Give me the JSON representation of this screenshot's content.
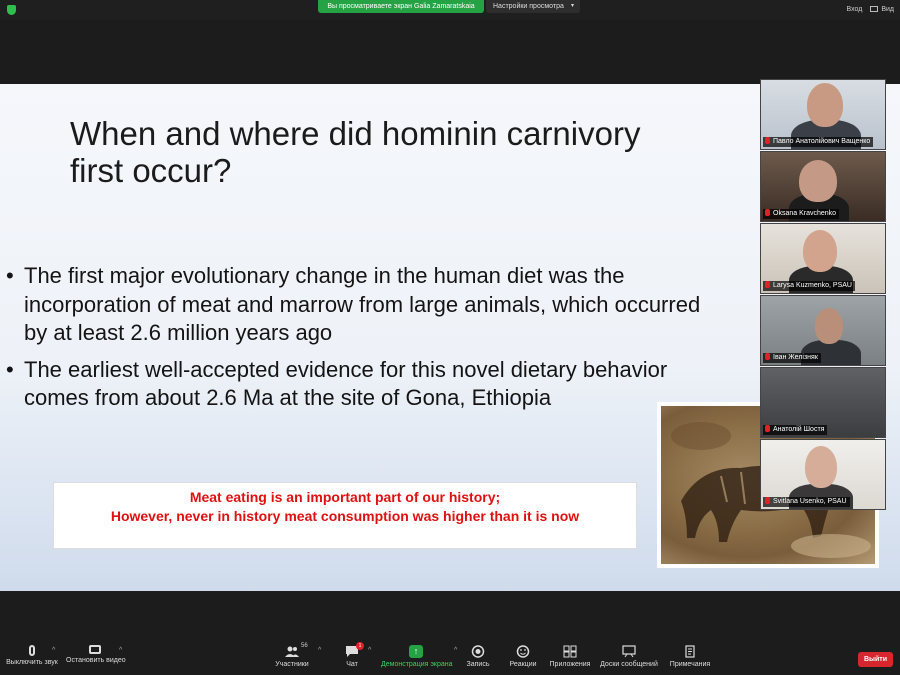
{
  "top_bar": {
    "share_banner": "Вы просматриваете экран Galia Zamaratskaia",
    "view_options": "Настройки просмотра",
    "signin": "Вход",
    "view": "Вид"
  },
  "slide": {
    "title": "When and where did hominin carnivory first occur?",
    "bullets": [
      "The first major evolutionary change in the human diet was the incorporation of meat and marrow from large animals, which occurred by at least 2.6 million years ago",
      "The earliest well-accepted evidence for this novel dietary behavior comes from about 2.6 Ma at the site of Gona, Ethiopia"
    ],
    "callout_line1": "Meat eating is an important part of our history;",
    "callout_line2": "However, never in history meat consumption was higher than it is now"
  },
  "participants": [
    {
      "name": "Павло Анатолійович Ващенко",
      "muted": true
    },
    {
      "name": "Oksana Kravchenko",
      "muted": true
    },
    {
      "name": "Larysa Kuzmenko, PSAU",
      "muted": true
    },
    {
      "name": "Іван Желізняк",
      "muted": true
    },
    {
      "name": "Анатолій Шостя",
      "muted": true
    },
    {
      "name": "Svitlana Usenko, PSAU",
      "muted": true
    }
  ],
  "toolbar": {
    "mute": "Выключить звук",
    "stop_video": "Остановить видео",
    "participants": "Участники",
    "participants_count": "56",
    "chat": "Чат",
    "chat_badge": "1",
    "share_screen": "Демонстрация экрана",
    "record": "Запись",
    "reactions": "Реакции",
    "apps": "Приложения",
    "whiteboards": "Доски сообщений",
    "notes": "Примечания",
    "leave": "Выйти"
  },
  "colors": {
    "share_green": "#25a244",
    "leave_red": "#d8262e",
    "callout_red": "#e01010"
  }
}
